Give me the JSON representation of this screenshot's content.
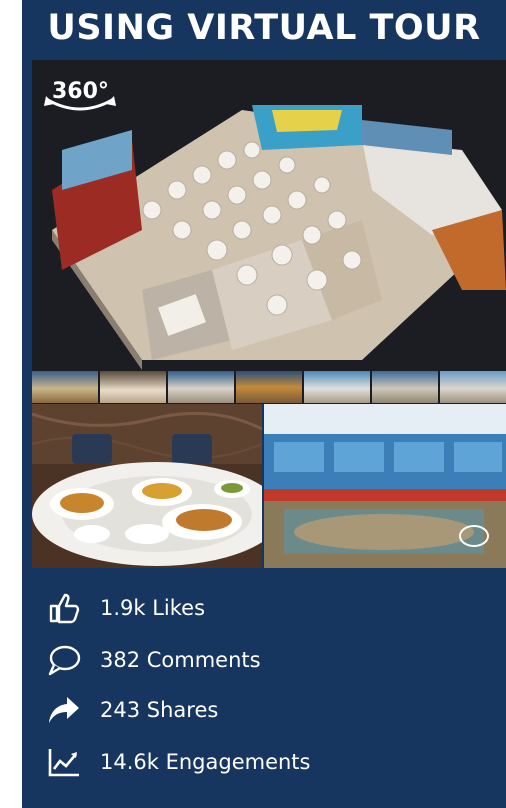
{
  "title": "USING VIRTUAL TOUR",
  "badge": {
    "label": "360°",
    "icon": "rotate-360-icon"
  },
  "colors": {
    "panel": "#17365f",
    "text": "#ffffff",
    "hero_bg": "#1b1d22"
  },
  "stats": [
    {
      "icon": "thumbs-up-icon",
      "label": "1.9k Likes"
    },
    {
      "icon": "comment-icon",
      "label": "382 Comments"
    },
    {
      "icon": "share-arrow-icon",
      "label": "243 Shares"
    },
    {
      "icon": "engagement-chart-icon",
      "label": "14.6k Engagements"
    }
  ]
}
